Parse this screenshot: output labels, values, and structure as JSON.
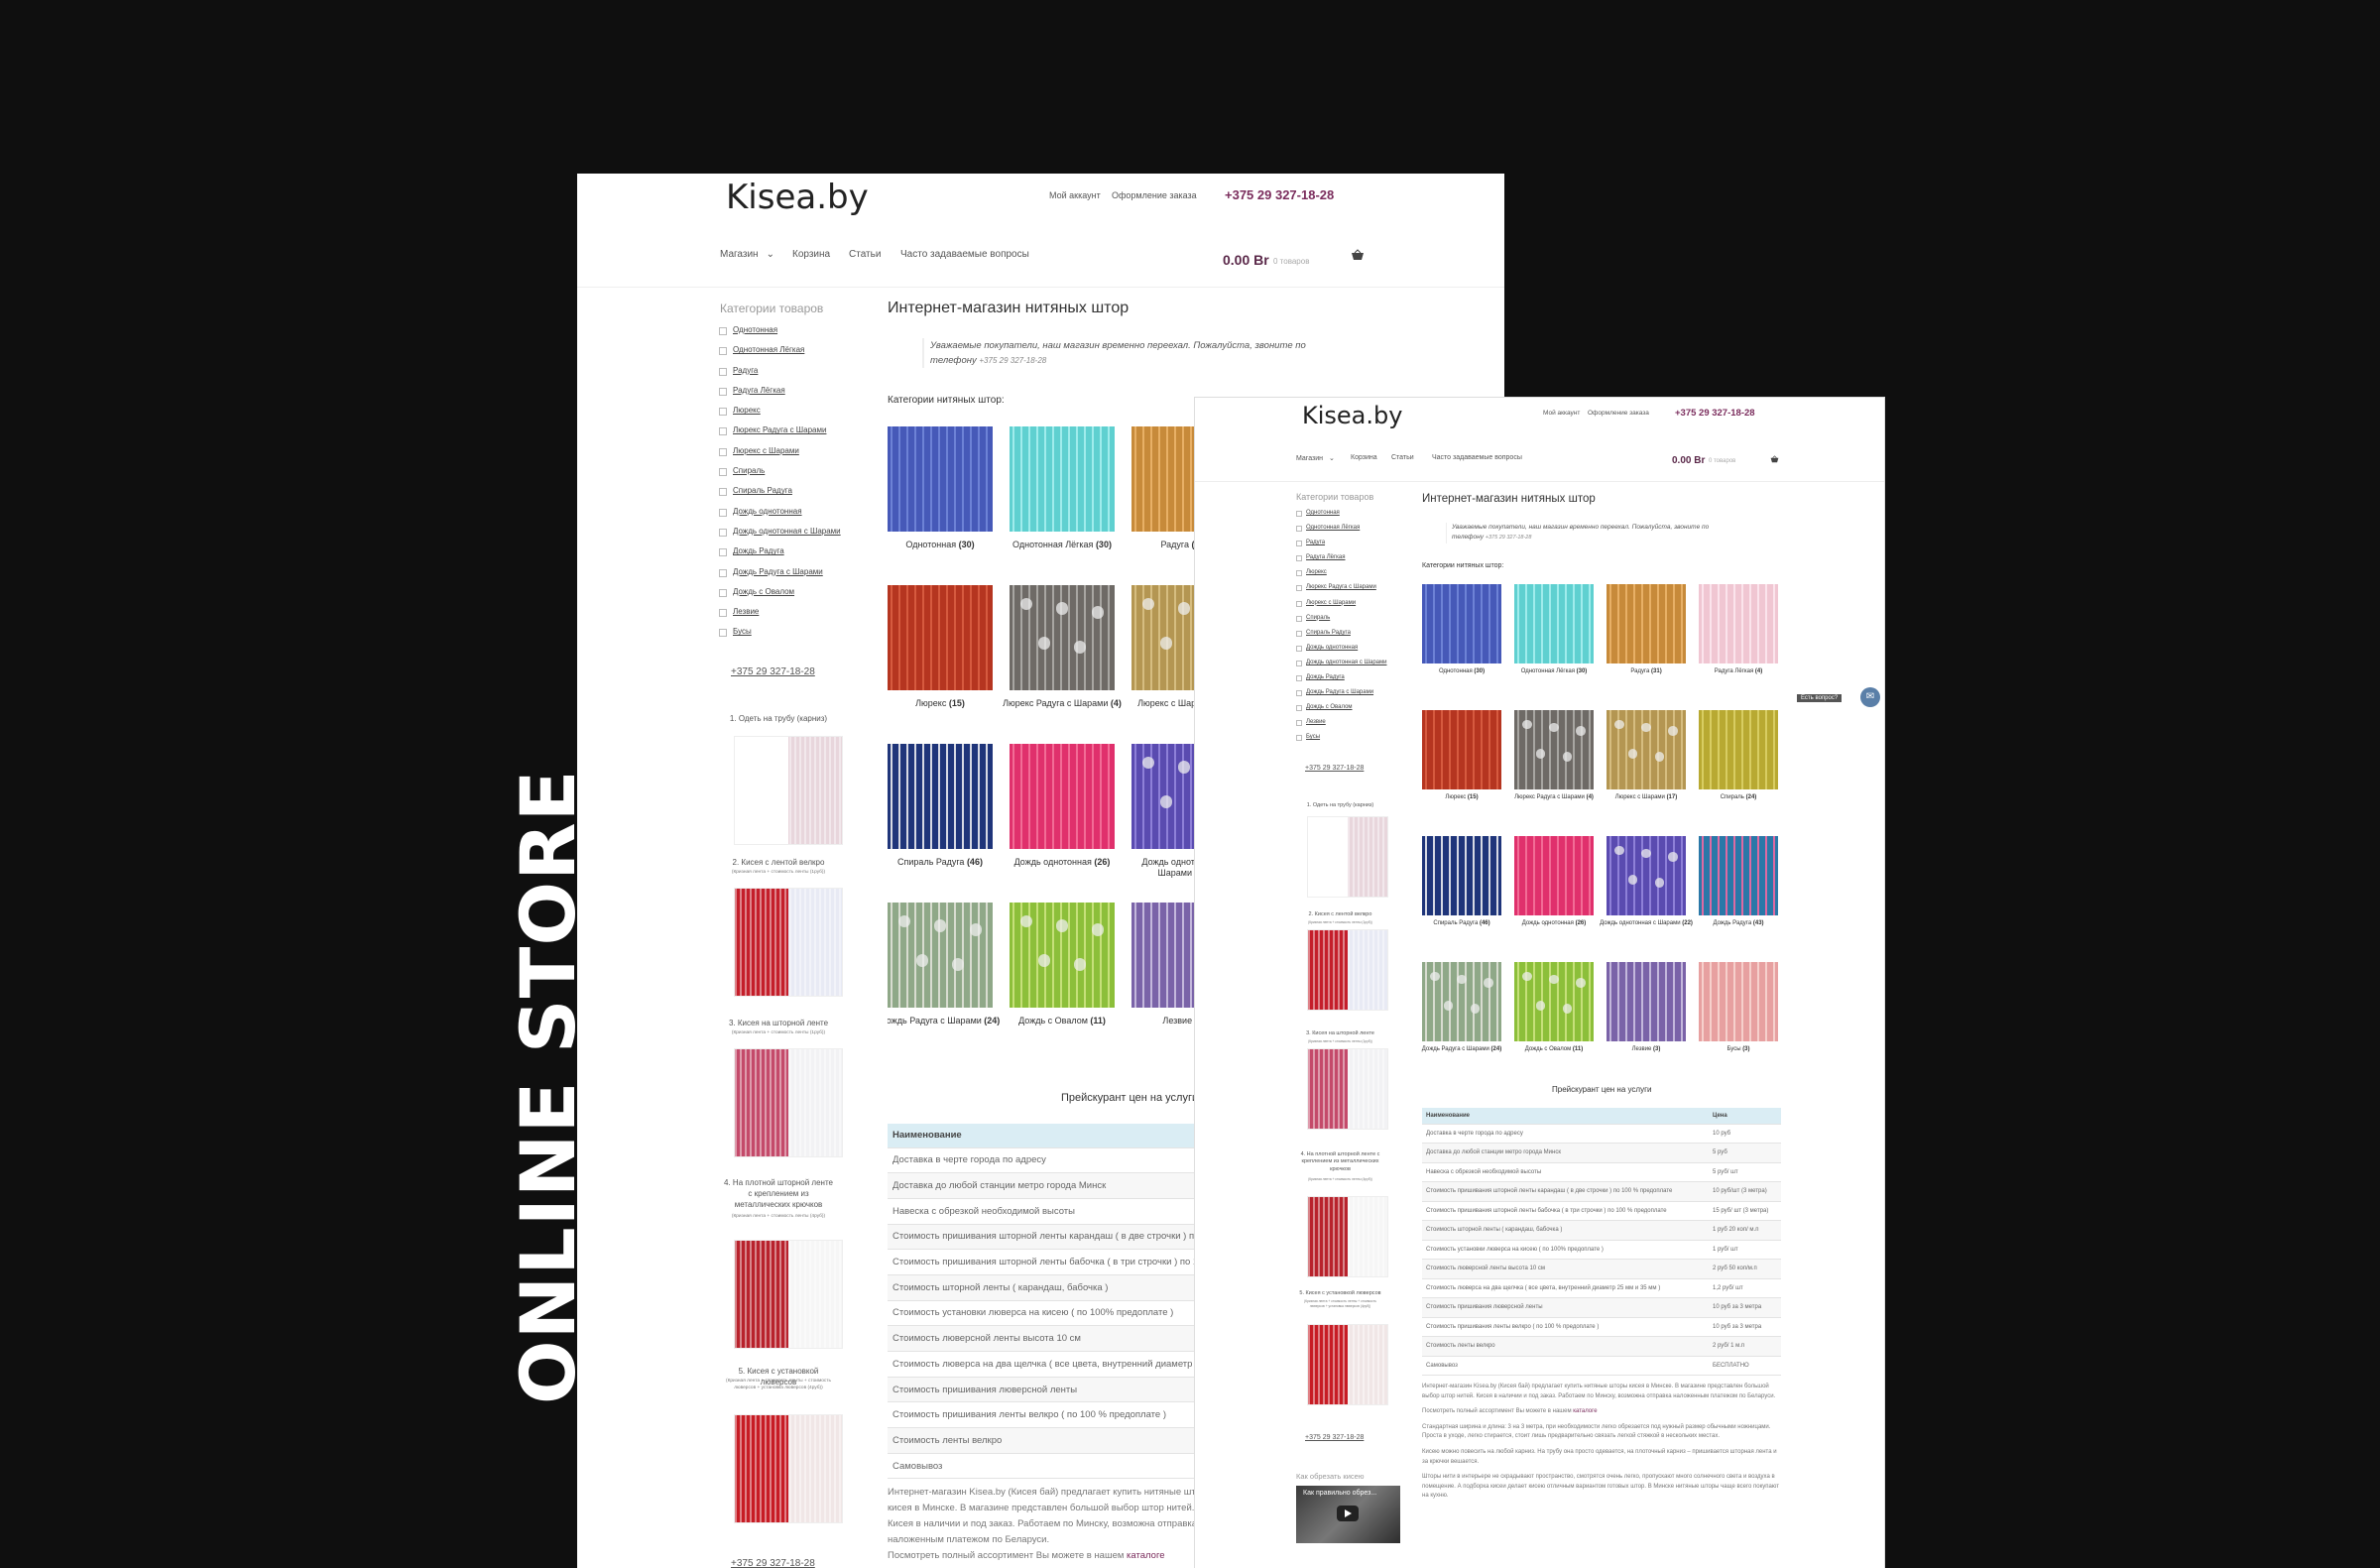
{
  "side_label": "ONLINE STORE",
  "store": {
    "logo": "Kisea.by",
    "my_account": "Мой аккаунт",
    "checkout": "Оформление заказа",
    "phone": "+375 29 327-18-28",
    "nav": {
      "shop": "Магазин",
      "cart": "Корзина",
      "articles": "Статьи",
      "faq": "Часто задаваемые вопросы"
    },
    "cart_total": "0.00 Br",
    "cart_count": "0 товаров",
    "sidebar_title": "Категории товаров",
    "categories": [
      "Однотонная",
      "Однотонная Лёгкая",
      "Радуга",
      "Радуга Лёгкая",
      "Люрекс",
      "Люрекс Радуга с Шарами",
      "Люрекс с Шарами",
      "Спираль",
      "Спираль Радуга",
      "Дождь однотонная",
      "Дождь однотонная с Шарами",
      "Дождь Радуга",
      "Дождь Радуга с Шарами",
      "Дождь с Овалом",
      "Лезвие",
      "Бусы"
    ],
    "sidebar_phone": "+375 29 327-18-28",
    "services": [
      {
        "title": "1. Одеть на трубу (карниз)",
        "note": ""
      },
      {
        "title": "2. Кисея с лентой велкро",
        "note": "(Кризная лента + стоимость ленты (1руб))"
      },
      {
        "title": "3. Кисея на шторной ленте",
        "note": "(Кризная лента + стоимость ленты (1руб))"
      },
      {
        "title": "4. На плотной шторной ленте с креплением из металлических крючков",
        "note": "(Кризная лента + стоимость ленты (4руб))"
      },
      {
        "title": "5. Кисея с установкой люверсов",
        "note": "(Кризная лента + стоимость ленты + стоимость люверсов + установка люверсов (4руб))"
      }
    ],
    "video_title": "Как обрезать кисею",
    "video_caption": "Как правильно обрез...",
    "page_title": "Интернет-магазин нитяных штор",
    "notice": "Уважаемые покупатели, наш магазин временно переехал. Пожалуйста, звоните по телефону",
    "notice_phone": "+375 29 327-18-28",
    "cat_heading": "Категории нитяных штор:",
    "products": [
      {
        "name": "Однотонная",
        "count": "(30)"
      },
      {
        "name": "Однотонная Лёгкая",
        "count": "(30)"
      },
      {
        "name": "Радуга",
        "count": "(31)"
      },
      {
        "name": "Радуга Лёгкая",
        "count": "(4)"
      },
      {
        "name": "Люрекс",
        "count": "(15)"
      },
      {
        "name": "Люрекс Радуга с Шарами",
        "count": "(4)"
      },
      {
        "name": "Люрекс с Шарами",
        "count": "(17)"
      },
      {
        "name": "Спираль",
        "count": "(24)"
      },
      {
        "name": "Спираль Радуга",
        "count": "(46)"
      },
      {
        "name": "Дождь однотонная",
        "count": "(26)"
      },
      {
        "name": "Дождь однотонная с Шарами",
        "count": "(22)"
      },
      {
        "name": "Дождь Радуга",
        "count": "(43)"
      },
      {
        "name": "Дождь Радуга с Шарами",
        "count": "(24)"
      },
      {
        "name": "Дождь с Овалом",
        "count": "(11)"
      },
      {
        "name": "Лезвие",
        "count": "(3)"
      },
      {
        "name": "Бусы",
        "count": "(3)"
      }
    ],
    "price_heading": "Прейскурант цен на услуги",
    "price_headers": {
      "name": "Наименование",
      "price": "Цена"
    },
    "price_rows": [
      {
        "name": "Доставка в черте города по адресу",
        "price": "10 руб"
      },
      {
        "name": "Доставка до любой станции метро города Минск",
        "price": "5 руб"
      },
      {
        "name": "Навеска с обрезкой необходимой высоты",
        "price": "5 руб/ шт"
      },
      {
        "name": "Стоимость пришивания шторной ленты карандаш ( в две строчки ) по 100 % предоплате",
        "price": "10 руб/шт (3 метра)"
      },
      {
        "name": "Стоимость пришивания шторной ленты бабочка ( в три строчки ) по 100 % предоплате",
        "price": "15 руб/ шт (3 метра)"
      },
      {
        "name": "Стоимость шторной ленты ( карандаш, бабочка )",
        "price": "1 руб 20 коп/ м.п"
      },
      {
        "name": "Стоимость установки люверса на кисею ( по 100% предоплате )",
        "price": "1 руб/ шт"
      },
      {
        "name": "Стоимость люверсной ленты высота 10 см",
        "price": "2 руб 50 коп/м.п"
      },
      {
        "name": "Стоимость люверса на два щелчка ( все цвета, внутренний диаметр 25 мм и 35 мм )",
        "price": "1,2 руб/ шт"
      },
      {
        "name": "Стоимость пришивания люверсной ленты",
        "price": "10 руб за 3 метра"
      },
      {
        "name": "Стоимость пришивания ленты велкро ( по 100 % предоплате )",
        "price": "10 руб за 3 метра"
      },
      {
        "name": "Стоимость ленты велкро",
        "price": "2 руб/ 1 м.п"
      },
      {
        "name": "Самовывоз",
        "price": "БЕСПЛАТНО"
      }
    ],
    "para1": "Интернет-магазин Kisea.by (Кисея бай) предлагает купить нитяные шторы кисея в Минске. В магазине представлен большой выбор штор нитей. Кисея в наличии и под заказ. Работаем по Минску, возможна отправка наложенным платежом по Беларуси.",
    "para2_text": "Посмотреть полный ассортимент Вы можете в нашем",
    "para2_link": "каталоге",
    "para3": "Стандартная ширина и длина: 3 на 3 метра, при необходимости легко обрезается под нужный размер обычными ножницами. Проста в уходе, легко стирается, стоит лишь предварительно связать легкой стяжкой в нескольких местах.",
    "para4": "Кисею можно повесить на любой карниз. На трубу она просто одевается, на плоточный карниз – пришивается шторная лента и за крючки вешается.",
    "para5": "Шторы нити в интерьере не скрадывают пространство, смотрятся очень легко, пропускают много солнечного света и воздуха в помещение. А подборка кисеи делает кисею отличным вариантом готовых штор. В Минске нитяные шторы чаще всего покупают на кухню.",
    "chat_label": "Есть вопрос?",
    "chat_icon": "✉"
  }
}
